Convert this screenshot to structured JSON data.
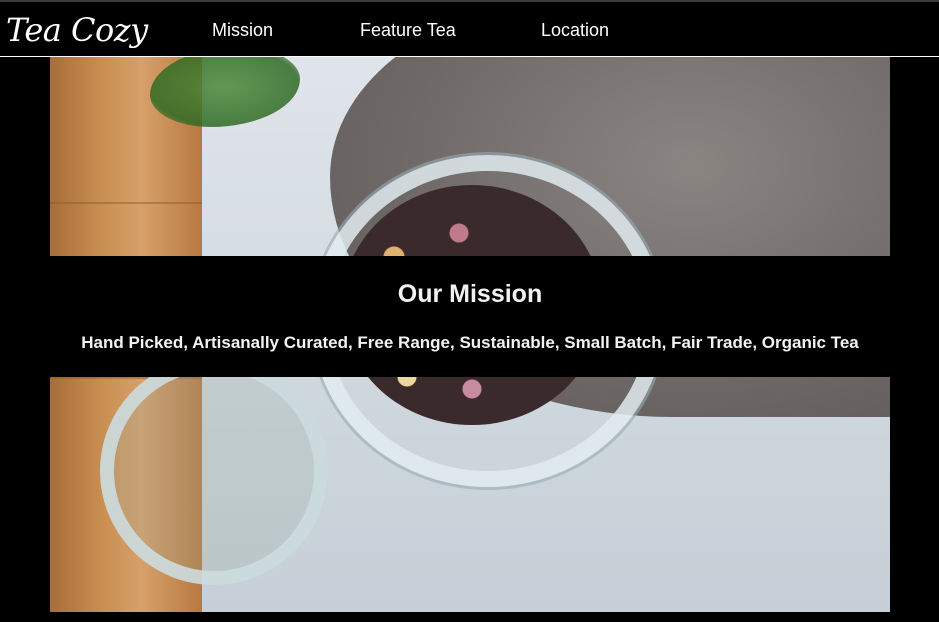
{
  "header": {
    "logo": "Tea Cozy",
    "nav": [
      {
        "label": "Mission"
      },
      {
        "label": "Feature Tea"
      },
      {
        "label": "Location"
      }
    ]
  },
  "hero": {
    "image": "tea-jar-photo"
  },
  "mission": {
    "title": "Our Mission",
    "text": "Hand Picked, Artisanally Curated, Free Range, Sustainable, Small Batch, Fair Trade, Organic Tea"
  },
  "colors": {
    "background": "#000000",
    "text": "#ffffff"
  }
}
